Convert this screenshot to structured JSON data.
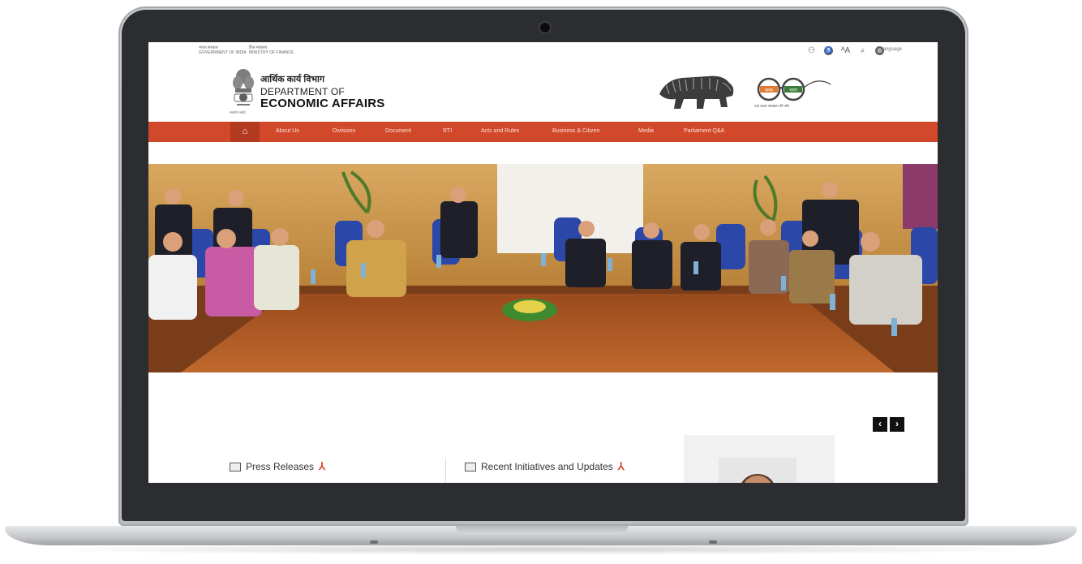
{
  "top_bar": {
    "gov_hindi": "भारत सरकार",
    "gov_english": "GOVERNMENT OF INDIA",
    "ministry_hindi": "वित्त मंत्रालय",
    "ministry_english": "MINISTRY OF FINANCE",
    "language_label": "Language",
    "icons": [
      "sitemap-icon",
      "accessibility-icon",
      "text-size-icon",
      "search-icon",
      "language-globe-icon"
    ]
  },
  "header": {
    "emblem_caption": "सत्यमेव जयते",
    "dept_hindi": "आर्थिक कार्य विभाग",
    "dept_line1": "DEPARTMENT OF",
    "dept_line2": "ECONOMIC AFFAIRS",
    "swachh_left": "स्वच्छ",
    "swachh_right": "भारत",
    "swachh_tagline": "एक कदम स्वच्छता की ओर"
  },
  "nav": {
    "home_icon": "home-icon",
    "items": [
      "About Us",
      "Divisions",
      "Document",
      "RTI",
      "Acts and Rules",
      "Business & Citizen",
      "Media",
      "Parliament Q&A"
    ]
  },
  "slider": {
    "prev_symbol": "‹",
    "next_symbol": "›"
  },
  "sections": {
    "press_releases": "Press Releases",
    "recent_initiatives": "Recent Initiatives and Updates"
  },
  "colors": {
    "nav_bar": "#d2482a",
    "nav_home": "#b23a20"
  }
}
